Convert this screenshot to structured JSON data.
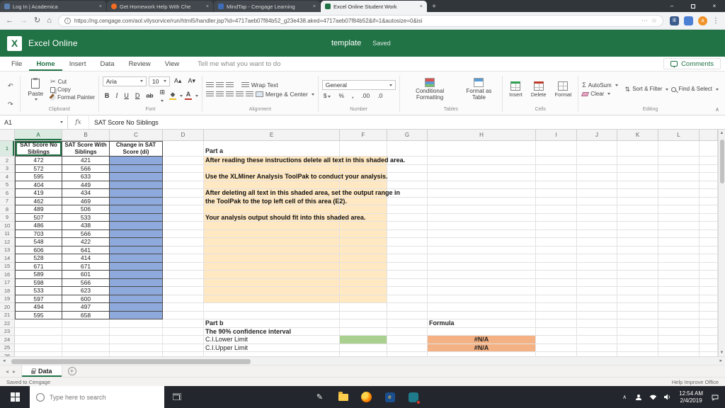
{
  "browser": {
    "tabs": [
      {
        "title": "Log In | Academica",
        "favicon_color": "#5b7fae",
        "active": false
      },
      {
        "title": "Get Homework Help With Che",
        "favicon_color": "#f26d21",
        "active": false
      },
      {
        "title": "MindTap - Cengage Learning",
        "favicon_color": "#3e6db5",
        "active": false
      },
      {
        "title": "Excel Online Student Work",
        "favicon_color": "#217346",
        "active": true
      }
    ],
    "url": "https://ng.cengage.com/aol.vilysorvice/run/html5/handler.jsp?id=4717aeb07f84b52_g23e438.aked=4717aeb07f84b52&if=1&autosize=0&isi",
    "extensions": [
      {
        "label": "lll",
        "color": "#3a5a8c"
      },
      {
        "label": "",
        "color": "#4a7fd4"
      },
      {
        "label": "a",
        "color": "#f0932b"
      }
    ]
  },
  "excel_header": {
    "app_name": "Excel Online",
    "doc_name": "template",
    "status": "Saved"
  },
  "menu": {
    "tabs": [
      "File",
      "Home",
      "Insert",
      "Data",
      "Review",
      "View"
    ],
    "active_tab": "Home",
    "tell_me": "Tell me what you want to do",
    "comments": "Comments"
  },
  "ribbon": {
    "clipboard": {
      "paste": "Paste",
      "cut": "Cut",
      "copy": "Copy",
      "format_painter": "Format Painter",
      "label": "Clipboard"
    },
    "font": {
      "name": "Aria",
      "size": "10",
      "label": "Font"
    },
    "alignment": {
      "wrap": "Wrap Text",
      "merge": "Merge & Center",
      "label": "Alignment"
    },
    "number": {
      "format": "General",
      "currency": "$",
      "percent": "%",
      "comma": ",",
      "inc_decimal": ".00",
      "dec_decimal": ".0",
      "label": "Number"
    },
    "tables": {
      "conditional": "Conditional Formatting",
      "format_table": "Format as Table",
      "label": "Tables"
    },
    "cells": {
      "insert": "Insert",
      "delete": "Delete",
      "format": "Format",
      "label": "Cells"
    },
    "editing": {
      "autosum": "AutoSum",
      "clear": "Clear",
      "sort": "Sort & Filter",
      "find": "Find & Select",
      "label": "Editing"
    }
  },
  "formula_bar": {
    "name_box": "A1",
    "fx": "fx",
    "content": "SAT Score  No Siblings"
  },
  "sheet": {
    "selection": "A1",
    "columns": [
      "A",
      "B",
      "C",
      "D",
      "E",
      "F",
      "G",
      "H",
      "I",
      "J",
      "K",
      "L"
    ],
    "row_count": 27,
    "table_headers": [
      "SAT Score No Siblings",
      "SAT Score With Siblings",
      "Change in SAT Score (di)"
    ],
    "data_rows": [
      [
        472,
        421
      ],
      [
        572,
        566
      ],
      [
        595,
        633
      ],
      [
        404,
        449
      ],
      [
        419,
        434
      ],
      [
        462,
        469
      ],
      [
        489,
        506
      ],
      [
        507,
        533
      ],
      [
        486,
        438
      ],
      [
        703,
        566
      ],
      [
        548,
        422
      ],
      [
        606,
        641
      ],
      [
        528,
        414
      ],
      [
        671,
        671
      ],
      [
        589,
        601
      ],
      [
        598,
        566
      ],
      [
        533,
        623
      ],
      [
        597,
        600
      ],
      [
        494,
        497
      ],
      [
        595,
        658
      ]
    ],
    "part_a": {
      "title": "Part a",
      "instructions": [
        {
          "row": 2,
          "text": "After reading these instructions delete all text in this shaded area."
        },
        {
          "row": 4,
          "text": "Use the XLMiner Analysis ToolPak to conduct your analysis."
        },
        {
          "row": 6,
          "text": "After deleting all text in this shaded area, set the output range in"
        },
        {
          "row": 7,
          "text": "the ToolPak to the top left cell of this area (E2)."
        },
        {
          "row": 9,
          "text": "Your analysis output should fit into this shaded area."
        }
      ]
    },
    "part_b": {
      "title": "Part b",
      "description": "The 90% confidence interval",
      "lower_label": "C.I.Lower Limit",
      "upper_label": "C.I.Upper Limit",
      "lower_value": "#N/A",
      "upper_value": "#N/A",
      "formula_header": "Formula"
    },
    "shading": {
      "blue_range": "C2:C21",
      "blue": "#8ea9db",
      "tan_range": "E2:F19",
      "tan": "#ffe8c2",
      "green_cell": "F24",
      "green": "#a9d08e",
      "orange_cells": [
        "H24",
        "H25"
      ],
      "orange": "#f4b183"
    }
  },
  "sheet_tabs": {
    "tab": "Data"
  },
  "status_bar": {
    "left": "Saved to Cengage",
    "right": "Help Improve Office"
  },
  "taskbar": {
    "search_placeholder": "Type here to search",
    "time": "12:54 AM",
    "date": "2/4/2019"
  },
  "theme": {
    "excel_green": "#217346"
  }
}
